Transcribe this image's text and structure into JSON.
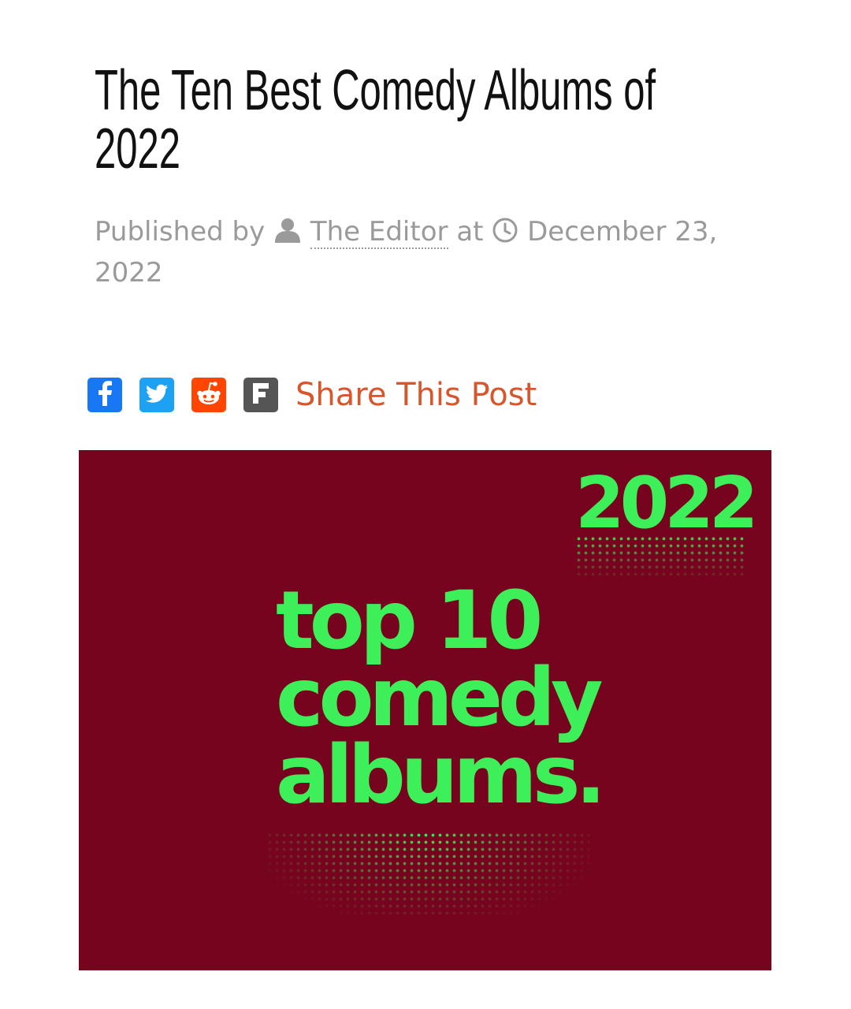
{
  "article": {
    "title_line1": "The Ten Best Comedy Albums of",
    "title_line2": "2022",
    "published_by": "Published by",
    "author": "The Editor",
    "at": "at",
    "date_line1": "December 23,",
    "date_line2": "2022"
  },
  "share": {
    "label": "Share This Post",
    "buttons": [
      {
        "name": "facebook",
        "color": "#1877f2",
        "glyph": "f"
      },
      {
        "name": "twitter",
        "color": "#1da1f2"
      },
      {
        "name": "reddit",
        "color": "#ff4500"
      },
      {
        "name": "flipboard",
        "color": "#555555",
        "glyph": "F"
      }
    ]
  },
  "hero_image": {
    "year": "2022",
    "line1": "top 10",
    "line2": "comedy",
    "line3": "albums.",
    "background": "#77041f",
    "text_color": "#3df05a"
  }
}
